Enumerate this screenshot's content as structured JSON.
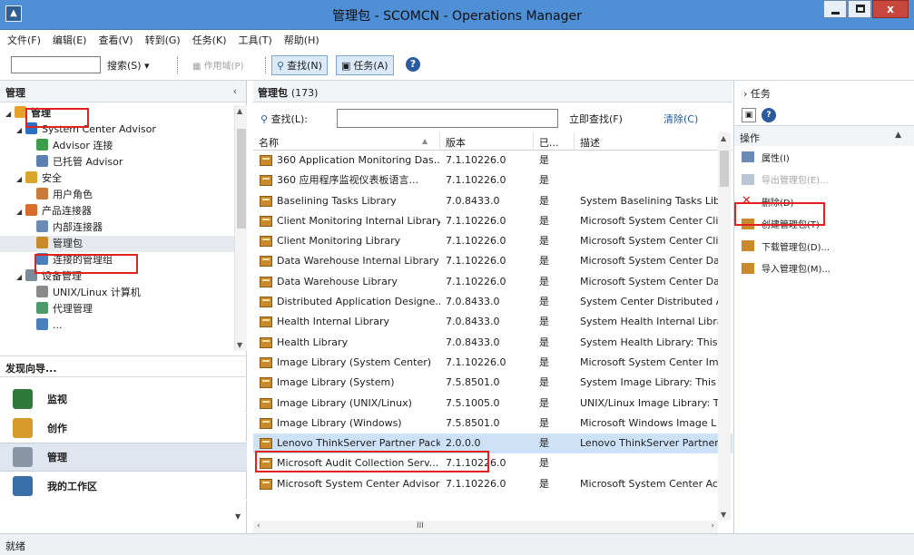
{
  "window": {
    "title": "管理包 - SCOMCN - Operations Manager",
    "close_label": "x"
  },
  "menu": [
    "文件(F)",
    "编辑(E)",
    "查看(V)",
    "转到(G)",
    "任务(K)",
    "工具(T)",
    "帮助(H)"
  ],
  "toolbar": {
    "search_label": "搜索(S) ▾",
    "scope_label": "作用域(P)",
    "find_label": "查找(N)",
    "tasks_label": "任务(A)",
    "help_label": "?"
  },
  "left": {
    "header": "管理",
    "tree": [
      {
        "label": "管理",
        "level": 0,
        "icon": "gear-icon",
        "color": "#e8a22a"
      },
      {
        "label": "System Center Advisor",
        "level": 1,
        "icon": "advisor-icon",
        "color": "#2a6fc4"
      },
      {
        "label": "Advisor 连接",
        "level": 2,
        "icon": "connect-icon",
        "color": "#3b9c4a"
      },
      {
        "label": "已托管 Advisor",
        "level": 2,
        "icon": "managed-icon",
        "color": "#5a7fb0"
      },
      {
        "label": "安全",
        "level": 1,
        "icon": "lock-icon",
        "color": "#d8a628"
      },
      {
        "label": "用户角色",
        "level": 2,
        "icon": "user-icon",
        "color": "#c97a3a"
      },
      {
        "label": "产品连接器",
        "level": 1,
        "icon": "connector-icon",
        "color": "#d86c2b"
      },
      {
        "label": "内部连接器",
        "level": 2,
        "icon": "internal-connector-icon",
        "color": "#6a8bb5"
      },
      {
        "label": "管理包",
        "level": 2,
        "icon": "package-icon",
        "color": "#c98a2c"
      },
      {
        "label": "连接的管理组",
        "level": 2,
        "icon": "group-icon",
        "color": "#4a7fbd"
      },
      {
        "label": "设备管理",
        "level": 1,
        "icon": "device-icon",
        "color": "#7a8b9c"
      },
      {
        "label": "UNIX/Linux 计算机",
        "level": 2,
        "icon": "computer-icon",
        "color": "#8a8a8a"
      },
      {
        "label": "代理管理",
        "level": 2,
        "icon": "agent-icon",
        "color": "#4a9a6a"
      },
      {
        "label": "...",
        "level": 2,
        "icon": "more-icon",
        "color": "#4a7fbd"
      }
    ],
    "discover": "发现向导...",
    "wunderbar": [
      {
        "label": "监视",
        "color": "#2f7a3a"
      },
      {
        "label": "创作",
        "color": "#d89a2a"
      },
      {
        "label": "管理",
        "color": "#8a96a6"
      },
      {
        "label": "我的工作区",
        "color": "#3a6ea8"
      }
    ]
  },
  "center": {
    "header": "管理包",
    "count": "(173)",
    "find_label": "查找(L):",
    "find_value": "",
    "find_now": "立即查找(F)",
    "clear": "清除(C)",
    "columns": [
      "名称",
      "版本",
      "已...",
      "描述"
    ],
    "rows": [
      {
        "name": "360 Application Monitoring Das...",
        "version": "7.1.10226.0",
        "sealed": "是",
        "desc": ""
      },
      {
        "name": "360 应用程序监视仪表板语言...",
        "version": "7.1.10226.0",
        "sealed": "是",
        "desc": ""
      },
      {
        "name": "Baselining Tasks Library",
        "version": "7.0.8433.0",
        "sealed": "是",
        "desc": "System Baselining Tasks Lib"
      },
      {
        "name": "Client Monitoring Internal Library",
        "version": "7.1.10226.0",
        "sealed": "是",
        "desc": "Microsoft System Center Cli"
      },
      {
        "name": "Client Monitoring Library",
        "version": "7.1.10226.0",
        "sealed": "是",
        "desc": "Microsoft System Center Cli"
      },
      {
        "name": "Data Warehouse Internal Library",
        "version": "7.1.10226.0",
        "sealed": "是",
        "desc": "Microsoft System Center Da"
      },
      {
        "name": "Data Warehouse Library",
        "version": "7.1.10226.0",
        "sealed": "是",
        "desc": "Microsoft System Center Da"
      },
      {
        "name": "Distributed Application Designe...",
        "version": "7.0.8433.0",
        "sealed": "是",
        "desc": "System Center Distributed A"
      },
      {
        "name": "Health Internal Library",
        "version": "7.0.8433.0",
        "sealed": "是",
        "desc": "System Health Internal Libra"
      },
      {
        "name": "Health Library",
        "version": "7.0.8433.0",
        "sealed": "是",
        "desc": "System Health Library: This"
      },
      {
        "name": "Image Library (System Center)",
        "version": "7.1.10226.0",
        "sealed": "是",
        "desc": "Microsoft System Center Im"
      },
      {
        "name": "Image Library (System)",
        "version": "7.5.8501.0",
        "sealed": "是",
        "desc": "System Image Library: This I"
      },
      {
        "name": "Image Library (UNIX/Linux)",
        "version": "7.5.1005.0",
        "sealed": "是",
        "desc": "UNIX/Linux Image Library: T"
      },
      {
        "name": "Image Library (Windows)",
        "version": "7.5.8501.0",
        "sealed": "是",
        "desc": "Microsoft Windows Image L"
      },
      {
        "name": "Lenovo ThinkServer Partner Pack",
        "version": "2.0.0.0",
        "sealed": "是",
        "desc": "Lenovo ThinkServer Partner"
      },
      {
        "name": "Microsoft Audit Collection Serv...",
        "version": "7.1.10226.0",
        "sealed": "是",
        "desc": ""
      },
      {
        "name": "Microsoft System Center Advisor",
        "version": "7.1.10226.0",
        "sealed": "是",
        "desc": "Microsoft System Center Ac"
      }
    ],
    "selected_row": 14,
    "hscroll_mid": "III"
  },
  "right": {
    "header": "任务",
    "section": "操作",
    "actions": [
      {
        "label": "属性(I)",
        "enabled": true,
        "icon": "properties-icon"
      },
      {
        "label": "导出管理包(E)...",
        "enabled": false,
        "icon": "export-icon"
      },
      {
        "label": "删除(D)",
        "enabled": true,
        "icon": "delete-icon"
      },
      {
        "label": "创建管理包(T)",
        "enabled": true,
        "icon": "create-icon"
      },
      {
        "label": "下载管理包(D)...",
        "enabled": true,
        "icon": "download-icon"
      },
      {
        "label": "导入管理包(M)...",
        "enabled": true,
        "icon": "import-icon"
      }
    ]
  },
  "status": "就绪",
  "colors": {
    "titlebar": "#4f8fd6",
    "selected_row": "#cde2f7",
    "highlight": "#e0241b"
  }
}
